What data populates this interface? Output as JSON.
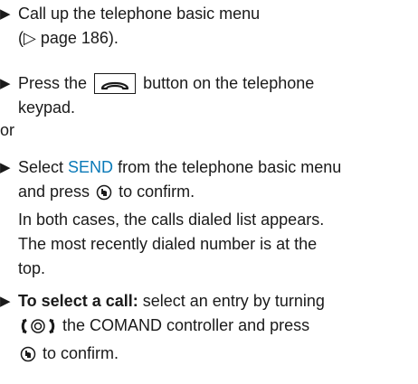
{
  "steps": [
    {
      "line1": "Call up the telephone basic menu",
      "line2": "(▷ page 186)."
    },
    {
      "before": "Press the",
      "after": "button on the telephone",
      "line2": "keypad."
    },
    {
      "or_label": "or"
    },
    {
      "select": "Select",
      "send": "SEND",
      "line1_rest": "from the telephone basic menu",
      "line2_before": "and press",
      "line2_after": "to confirm.",
      "line3": "In both cases, the calls dialed list appears.",
      "line4": "The most recently dialed number is at the",
      "line5": "top."
    },
    {
      "bold": "To select a call:",
      "line1_rest": "select an entry by turning",
      "line2_rest": "the COMAND controller and press",
      "line3_rest": "to confirm."
    }
  ],
  "icons": {
    "bullet": "triangle-bullet",
    "phone": "phone-handset-icon",
    "press": "press-controller-icon",
    "turn": "turn-controller-icon"
  }
}
